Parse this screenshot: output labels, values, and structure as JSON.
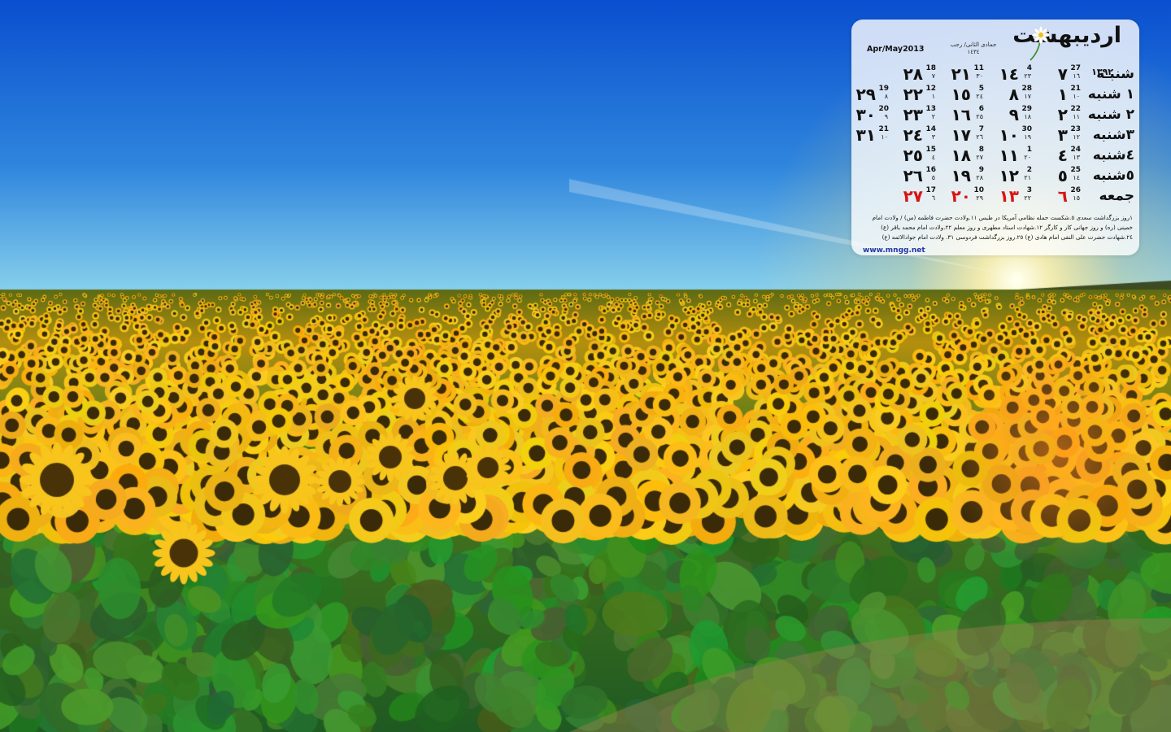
{
  "colors": {
    "sky_top": "#0a4fd0",
    "sky_horizon": "#8fd6ee",
    "sunflower": "#f7c51c",
    "leaf": "#2f6f1e",
    "holiday_red": "#d81414",
    "link_blue": "#2234a8"
  },
  "calendar": {
    "month_title": "اردیبهشت",
    "month_digits": [
      "١",
      "٣",
      "٩",
      "٢"
    ],
    "gregorian_label": "Apr/May2013",
    "hijri_months": "جمادی الثانی/ رجب",
    "hijri_year": "١٤٣٤",
    "flower_icon": "daisy-icon",
    "rows": [
      {
        "day": "شنبـه",
        "cells": [
          {
            "num": "٧",
            "g": "27",
            "h": "١٦"
          },
          {
            "num": "١٤",
            "g": "4",
            "h": "٢٣"
          },
          {
            "num": "٢١",
            "g": "11",
            "h": "٣٠"
          },
          {
            "num": "٢٨",
            "g": "18",
            "h": "٧"
          }
        ]
      },
      {
        "day": "١ شنبه",
        "cells": [
          {
            "num": "١",
            "g": "21",
            "h": "١٠"
          },
          {
            "num": "٨",
            "g": "28",
            "h": "١٧"
          },
          {
            "num": "١٥",
            "g": "5",
            "h": "٢٤"
          },
          {
            "num": "٢٢",
            "g": "12",
            "h": "١"
          },
          {
            "num": "٢٩",
            "g": "19",
            "h": "٨"
          }
        ]
      },
      {
        "day": "٢ شنبه",
        "cells": [
          {
            "num": "٢",
            "g": "22",
            "h": "١١"
          },
          {
            "num": "٩",
            "g": "29",
            "h": "١٨"
          },
          {
            "num": "١٦",
            "g": "6",
            "h": "٢٥"
          },
          {
            "num": "٢٣",
            "g": "13",
            "h": "٢"
          },
          {
            "num": "٣٠",
            "g": "20",
            "h": "٩"
          }
        ]
      },
      {
        "day": "٣شنبه",
        "cells": [
          {
            "num": "٣",
            "g": "23",
            "h": "١٢"
          },
          {
            "num": "١٠",
            "g": "30",
            "h": "١٩"
          },
          {
            "num": "١٧",
            "g": "7",
            "h": "٢٦"
          },
          {
            "num": "٢٤",
            "g": "14",
            "h": "٣"
          },
          {
            "num": "٣١",
            "g": "21",
            "h": "١٠"
          }
        ]
      },
      {
        "day": "٤شنبه",
        "cells": [
          {
            "num": "٤",
            "g": "24",
            "h": "١٣"
          },
          {
            "num": "١١",
            "g": "1",
            "h": "٢٠"
          },
          {
            "num": "١٨",
            "g": "8",
            "h": "٢٧"
          },
          {
            "num": "٢٥",
            "g": "15",
            "h": "٤"
          }
        ]
      },
      {
        "day": "٥شنبه",
        "cells": [
          {
            "num": "٥",
            "g": "25",
            "h": "١٤"
          },
          {
            "num": "١٢",
            "g": "2",
            "h": "٢١"
          },
          {
            "num": "١٩",
            "g": "9",
            "h": "٢٨"
          },
          {
            "num": "٢٦",
            "g": "16",
            "h": "٥"
          }
        ]
      },
      {
        "day": "جمعه",
        "cells": [
          {
            "num": "٦",
            "g": "26",
            "h": "١٥",
            "holiday": true
          },
          {
            "num": "١٣",
            "g": "3",
            "h": "٢٢",
            "holiday": true
          },
          {
            "num": "٢٠",
            "g": "10",
            "h": "٢٩",
            "holiday": true
          },
          {
            "num": "٢٧",
            "g": "17",
            "h": "٦",
            "holiday": true
          }
        ]
      }
    ],
    "notes": [
      "١روز بزرگداشت سعدی ٥.شکست حمله نظامی آمریکا در طبس ١١.ولادت حضرت فاطمه (س) / ولادت امام",
      "خمینی (ره) و روز جهانی کار و کارگر ١٢.شهادت استاد مطهری و روز معلم ٢٢.ولادت امام محمد باقر (ع)",
      "٢٤.شهادت حضرت علی النقی امام هادی (ع) ٢٥.روز بزرگداشت فردوسی ٣١. ولادت امام جوادالائمه (ع)"
    ],
    "website": "www.mngg.net"
  }
}
